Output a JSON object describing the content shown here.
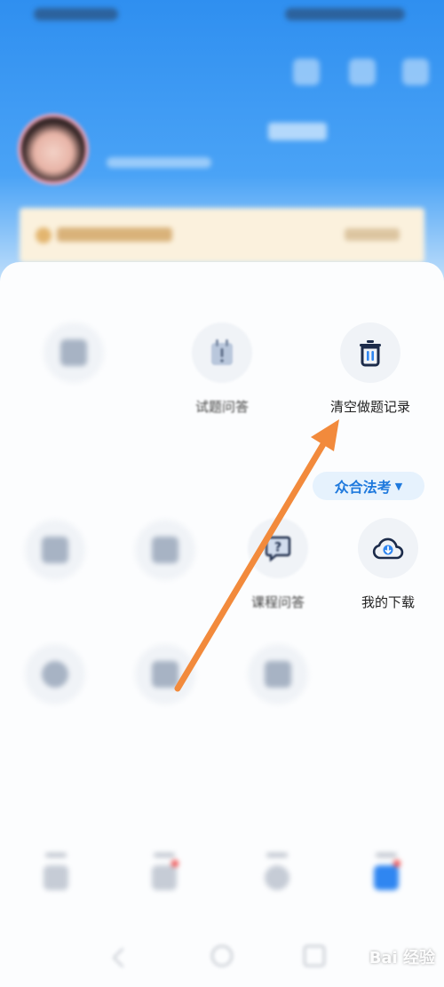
{
  "colors": {
    "header_blue": "#2f8ff0",
    "accent_blue": "#1e79dd",
    "annotation_arrow": "#f28a3c",
    "vip_banner": "#fbf1dd"
  },
  "section1": {
    "title": "",
    "items": [
      {
        "label": "",
        "icon": "blurred-placeholder-icon"
      },
      {
        "label": "试题问答",
        "icon": "calendar-alert-icon"
      },
      {
        "label": "清空做题记录",
        "icon": "trash-icon"
      }
    ]
  },
  "section2": {
    "title": "",
    "org_selector": {
      "label": "众合法考",
      "icon": "caret-down-icon"
    },
    "row1": [
      {
        "label": "",
        "icon": "blurred-placeholder-icon"
      },
      {
        "label": "",
        "icon": "blurred-placeholder-icon"
      },
      {
        "label": "课程问答",
        "icon": "question-bubble-icon"
      },
      {
        "label": "我的下载",
        "icon": "cloud-download-icon"
      }
    ],
    "row2": [
      {
        "label": "",
        "icon": "blurred-placeholder-icon"
      },
      {
        "label": "",
        "icon": "blurred-placeholder-icon"
      },
      {
        "label": "",
        "icon": "blurred-placeholder-icon"
      }
    ]
  },
  "section3": {
    "title": ""
  },
  "watermark": {
    "text": "Bai 经验"
  }
}
